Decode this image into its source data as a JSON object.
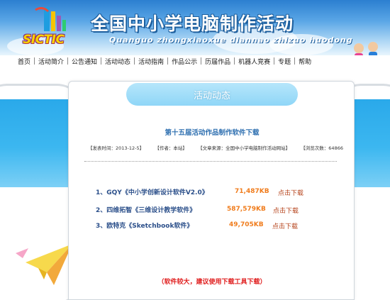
{
  "banner": {
    "logo_text": "SICTIC",
    "title": "全国中小学电脑制作活动",
    "subtitle": "Quanguo zhongxiaoxue diannao zhizuo huodong"
  },
  "nav": {
    "items": [
      {
        "label": "首页"
      },
      {
        "label": "活动简介"
      },
      {
        "label": "公告通知"
      },
      {
        "label": "活动动态"
      },
      {
        "label": "活动指南"
      },
      {
        "label": "作品公示"
      },
      {
        "label": "历届作品"
      },
      {
        "label": "机器人竞赛"
      },
      {
        "label": "专题"
      },
      {
        "label": "帮助"
      }
    ]
  },
  "section": {
    "tab_label": "活动动态"
  },
  "article": {
    "title": "第十五届活动作品制作软件下载",
    "meta": {
      "publish_time": "【发表时间：2013-12-5】",
      "author": "【作者：本站】",
      "source": "【文章来源：全国中小学电脑制作活动网站】",
      "views": "【浏览次数：64866"
    },
    "downloads": [
      {
        "name": "1、GQY《中小学创新设计软件V2.0》",
        "size": "71,487KB",
        "link": "点击下载"
      },
      {
        "name": "2、四维拓智《三维设计教学软件》",
        "size": "587,579KB",
        "link": "点击下载"
      },
      {
        "name": "3、欧特克《Sketchbook软件》",
        "size": "49,705KB",
        "link": "点击下载"
      }
    ],
    "note": "（软件较大，建议使用下载工具下载）"
  },
  "colors": {
    "banner_top": "#2b7fd0",
    "stripe": "#3cb7f0",
    "tab": "#8fd6f7",
    "title_blue": "#2e6fb0",
    "size_orange": "#f07c1c",
    "note_red": "#e02020"
  }
}
